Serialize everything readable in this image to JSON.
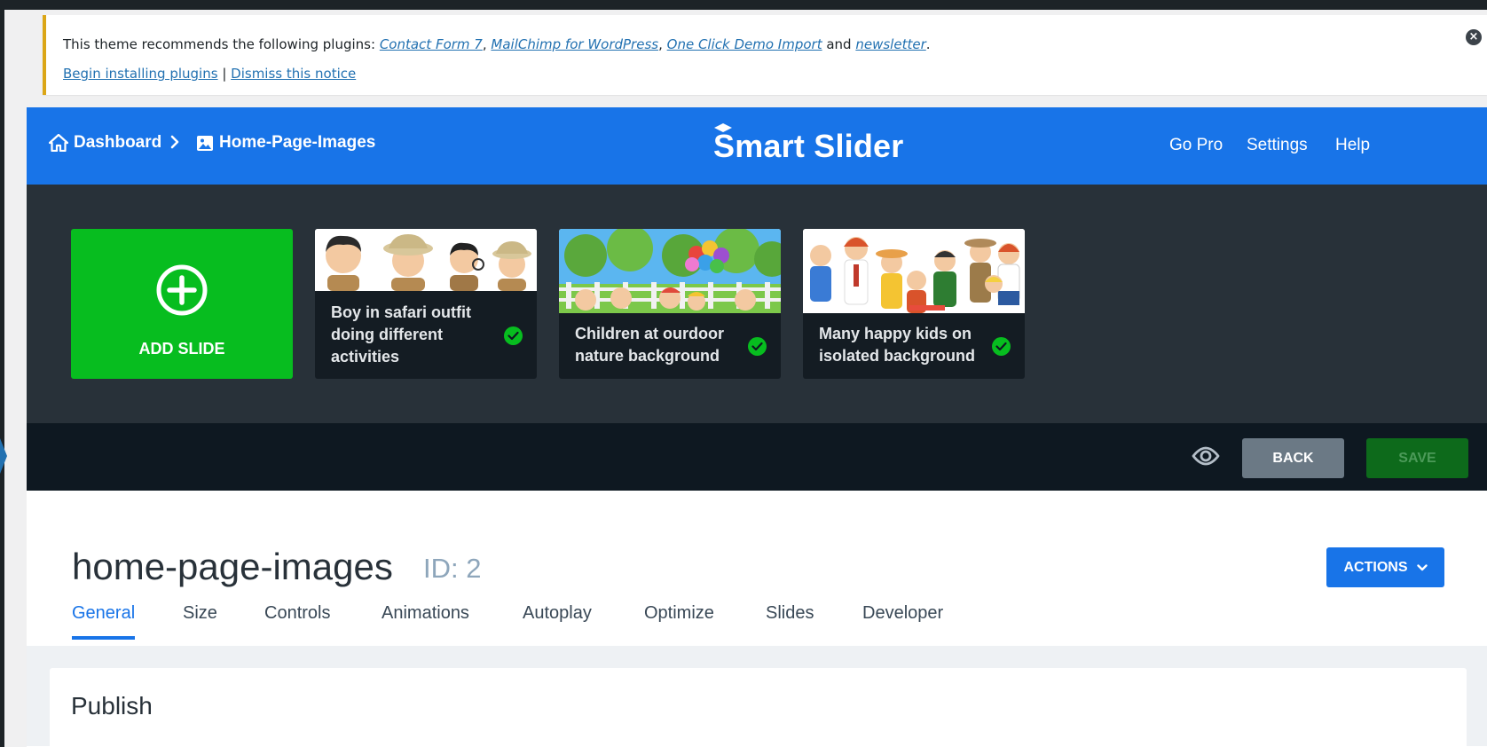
{
  "notice": {
    "prefix": "This theme recommends the following plugins: ",
    "plugins": [
      "Contact Form 7",
      "MailChimp for WordPress",
      "One Click Demo Import",
      "newsletter"
    ],
    "comma": ", ",
    "and": " and ",
    "period": ".",
    "begin_link": "Begin installing plugins",
    "separator": " | ",
    "dismiss_link": "Dismiss this notice"
  },
  "header": {
    "breadcrumb": [
      {
        "label": "Dashboard",
        "icon": "home-icon"
      },
      {
        "label": "Home-Page-Images",
        "icon": "image-icon"
      }
    ],
    "breadcrumb_separator": ">",
    "logo": "Smart Slider",
    "nav": [
      "Go Pro",
      "Settings",
      "Help"
    ]
  },
  "slides": {
    "add_label": "ADD SLIDE",
    "items": [
      {
        "title": "Boy in safari outfit doing different activities",
        "published": true
      },
      {
        "title": "Children at ourdoor nature background",
        "published": true
      },
      {
        "title": "Many happy kids on isolated background",
        "published": true
      }
    ]
  },
  "toolbar": {
    "back_label": "BACK",
    "save_label": "SAVE"
  },
  "slider": {
    "title": "home-page-images",
    "id_label": "ID: 2",
    "actions_label": "ACTIONS"
  },
  "tabs": [
    "General",
    "Size",
    "Controls",
    "Animations",
    "Autoplay",
    "Optimize",
    "Slides",
    "Developer"
  ],
  "active_tab": "General",
  "panel": {
    "title": "Publish"
  },
  "colors": {
    "brand_blue": "#1874e8",
    "add_green": "#07bd1f",
    "save_green": "#0d6a1b",
    "notice_border": "#dba617",
    "dark_panel": "#283139"
  }
}
